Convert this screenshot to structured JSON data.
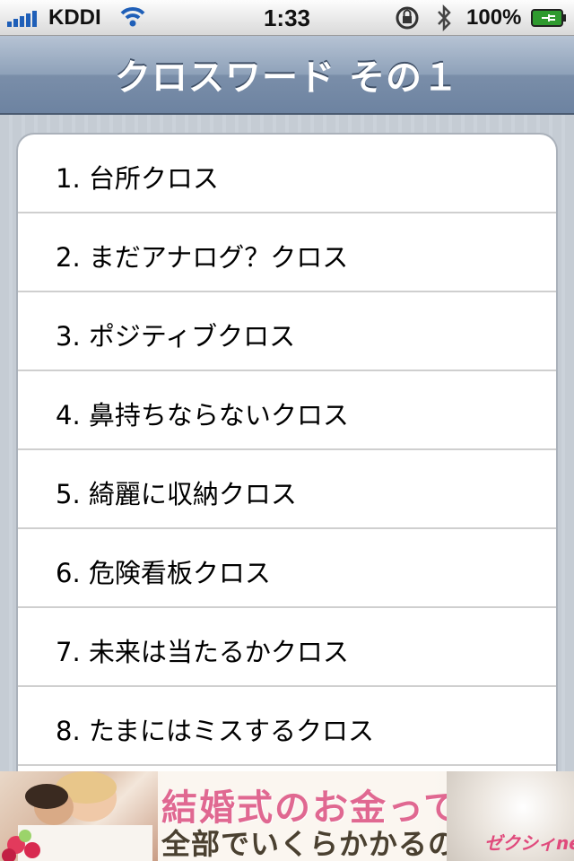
{
  "status_bar": {
    "carrier": "KDDI",
    "time": "1:33",
    "battery_percent": "100%",
    "icons": [
      "signal-icon",
      "wifi-icon",
      "rotation-lock-icon",
      "bluetooth-icon",
      "battery-icon"
    ]
  },
  "nav": {
    "title": "クロスワード その１"
  },
  "list": {
    "items": [
      {
        "label": "1.  台所クロス"
      },
      {
        "label": "2.  まだアナログ？クロス"
      },
      {
        "label": "3.  ポジティブクロス"
      },
      {
        "label": "4.  鼻持ちならないクロス"
      },
      {
        "label": "5.  綺麗に収納クロス"
      },
      {
        "label": "6.  危険看板クロス"
      },
      {
        "label": "7.  未来は当たるかクロス"
      },
      {
        "label": "8.  たまにはミスするクロス"
      }
    ]
  },
  "ad": {
    "line1": "結婚式のお金って",
    "line2": "全部でいくらかかるの？",
    "brand": "ゼクシィnet"
  },
  "colors": {
    "nav_bar": "#7a8ea9",
    "ad_pink": "#e06891"
  }
}
